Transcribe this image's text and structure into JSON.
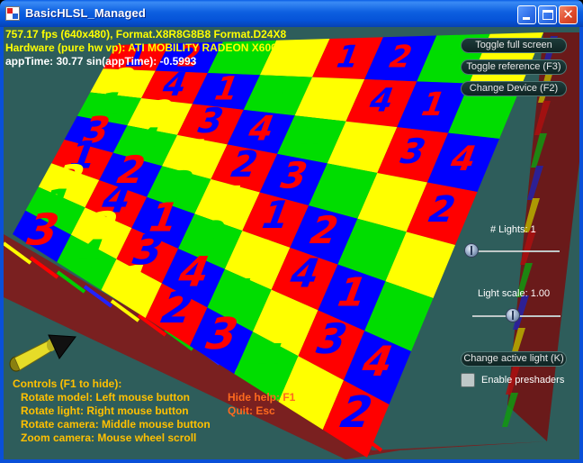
{
  "window": {
    "title": "BasicHLSL_Managed",
    "buttons": {
      "minimize": "minimize-icon",
      "maximize": "maximize-icon",
      "close": "close-icon"
    },
    "colors": {
      "titlebar": "#0553d8",
      "viewport_background": "#2e5d5b"
    }
  },
  "stats": {
    "line1": "757.17 fps (640x480), Format.X8R8G8B8 Format.D24X8",
    "line2": "Hardware (pure hw vp): ATI MOBILITY RADEON X600",
    "line3": "appTime: 30.77 sin(appTime): -0.5993"
  },
  "controls_panel": {
    "toggle_full_screen": "Toggle full screen",
    "toggle_reference": "Toggle reference (F3)",
    "change_device": "Change Device (F2)",
    "lights_label": "# Lights: 1",
    "lights_slider_value": 0.0,
    "light_scale_label": "Light scale: 1.00",
    "light_scale_slider_value": 0.5,
    "change_active_light": "Change active light (K)",
    "enable_preshaders_label": "Enable preshaders",
    "enable_preshaders_checked": false
  },
  "help": {
    "title": "Controls (F1 to hide):",
    "lines": [
      "Rotate model: Left mouse button",
      "Rotate light: Right mouse button",
      "Rotate camera: Middle mouse button",
      "Zoom camera: Mouse wheel scroll"
    ],
    "hide_help": "Hide help: F1",
    "quit": "Quit: Esc"
  },
  "scene": {
    "tile_colors": [
      "#ff0000",
      "#ffff00",
      "#00dd00",
      "#0000ff"
    ],
    "tile_digits": [
      "1",
      "2",
      "3",
      "4"
    ],
    "light_arrow_color": "#e6dc28"
  }
}
